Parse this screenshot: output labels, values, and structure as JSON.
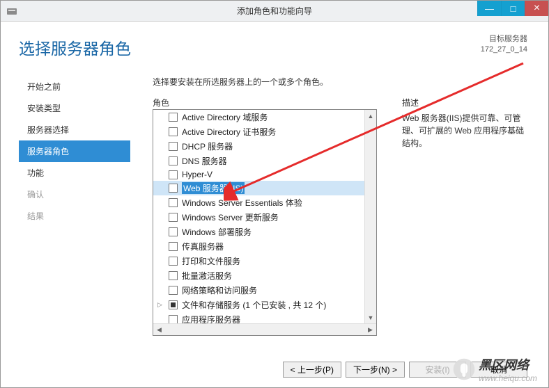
{
  "window": {
    "title": "添加角色和功能向导"
  },
  "page": {
    "title": "选择服务器角色",
    "target_label": "目标服务器",
    "target_value": "172_27_0_14",
    "instruction": "选择要安装在所选服务器上的一个或多个角色。",
    "roles_label": "角色",
    "desc_label": "描述",
    "desc_text": "Web 服务器(IIS)提供可靠、可管理、可扩展的 Web 应用程序基础结构。"
  },
  "sidebar": {
    "items": [
      {
        "label": "开始之前",
        "state": "normal"
      },
      {
        "label": "安装类型",
        "state": "normal"
      },
      {
        "label": "服务器选择",
        "state": "normal"
      },
      {
        "label": "服务器角色",
        "state": "active"
      },
      {
        "label": "功能",
        "state": "normal"
      },
      {
        "label": "确认",
        "state": "disabled"
      },
      {
        "label": "结果",
        "state": "disabled"
      }
    ]
  },
  "roles": [
    {
      "label": "Active Directory 域服务",
      "highlight": false,
      "checked": false
    },
    {
      "label": "Active Directory 证书服务",
      "highlight": false,
      "checked": false
    },
    {
      "label": "DHCP 服务器",
      "highlight": false,
      "checked": false
    },
    {
      "label": "DNS 服务器",
      "highlight": false,
      "checked": false
    },
    {
      "label": "Hyper-V",
      "highlight": false,
      "checked": false
    },
    {
      "label": "Web 服务器(IIS)",
      "highlight": true,
      "checked": false
    },
    {
      "label": "Windows Server Essentials 体验",
      "highlight": false,
      "checked": false
    },
    {
      "label": "Windows Server 更新服务",
      "highlight": false,
      "checked": false
    },
    {
      "label": "Windows 部署服务",
      "highlight": false,
      "checked": false
    },
    {
      "label": "传真服务器",
      "highlight": false,
      "checked": false
    },
    {
      "label": "打印和文件服务",
      "highlight": false,
      "checked": false
    },
    {
      "label": "批量激活服务",
      "highlight": false,
      "checked": false
    },
    {
      "label": "网络策略和访问服务",
      "highlight": false,
      "checked": false
    },
    {
      "label": "文件和存储服务 (1 个已安装 ,  共 12 个)",
      "highlight": false,
      "checked": "partial",
      "expander": true
    },
    {
      "label": "应用程序服务器",
      "highlight": false,
      "checked": false
    }
  ],
  "buttons": {
    "prev": "< 上一步(P)",
    "next": "下一步(N) >",
    "install": "安装(I)",
    "cancel": "取消"
  },
  "watermark": {
    "title": "黑区网络",
    "url": "www.heiqu.com"
  }
}
